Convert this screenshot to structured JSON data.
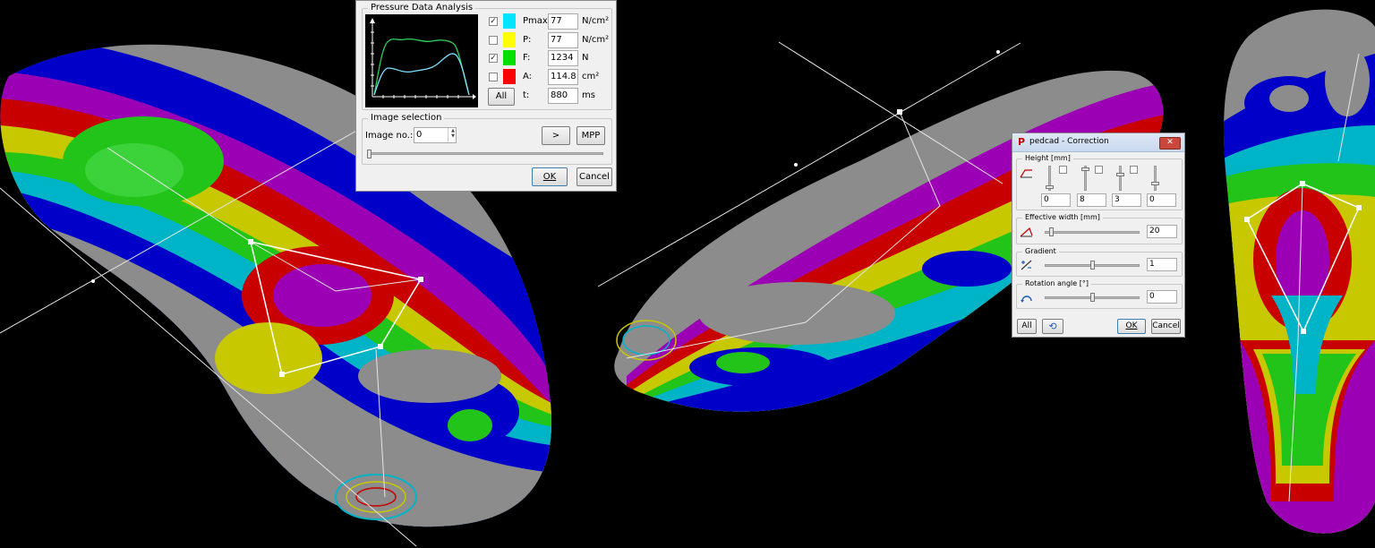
{
  "pressure_dialog": {
    "title": "Pressure Data Analysis",
    "rows": [
      {
        "label": "Pmax:",
        "value": "77",
        "unit": "N/cm²",
        "color": "#00e5ff",
        "checked": true
      },
      {
        "label": "P:",
        "value": "77",
        "unit": "N/cm²",
        "color": "#ffff00",
        "checked": false
      },
      {
        "label": "F:",
        "value": "1234",
        "unit": "N",
        "color": "#00e000",
        "checked": true
      },
      {
        "label": "A:",
        "value": "114.8",
        "unit": "cm²",
        "color": "#ff0000",
        "checked": false
      },
      {
        "label": "t:",
        "value": "880",
        "unit": "ms"
      }
    ],
    "all_button": "All",
    "image_selection": {
      "title": "Image selection",
      "image_no_label": "Image no.:",
      "image_no_value": "0",
      "next_button": ">",
      "mpp_button": "MPP",
      "slider_position": 0
    },
    "ok_button": "OK",
    "cancel_button": "Cancel"
  },
  "correction_dialog": {
    "title": "pedcad - Correction",
    "app_icon": "P",
    "height": {
      "title": "Height [mm]",
      "values": [
        "0",
        "8",
        "3",
        "0"
      ]
    },
    "effective_width": {
      "title": "Effective width [mm]",
      "value": "20"
    },
    "gradient": {
      "title": "Gradient",
      "value": "1"
    },
    "rotation": {
      "title": "Rotation angle [°]",
      "value": "0"
    },
    "all_button": "All",
    "ok_button": "OK",
    "cancel_button": "Cancel"
  },
  "colors": {
    "background": "#000000",
    "insole_gray": "#8c8c8c",
    "blue": "#0000c8",
    "cyan": "#00b4c8",
    "green": "#22c41a",
    "yellow": "#c8c800",
    "red": "#c80000",
    "magenta": "#9b00b4"
  }
}
